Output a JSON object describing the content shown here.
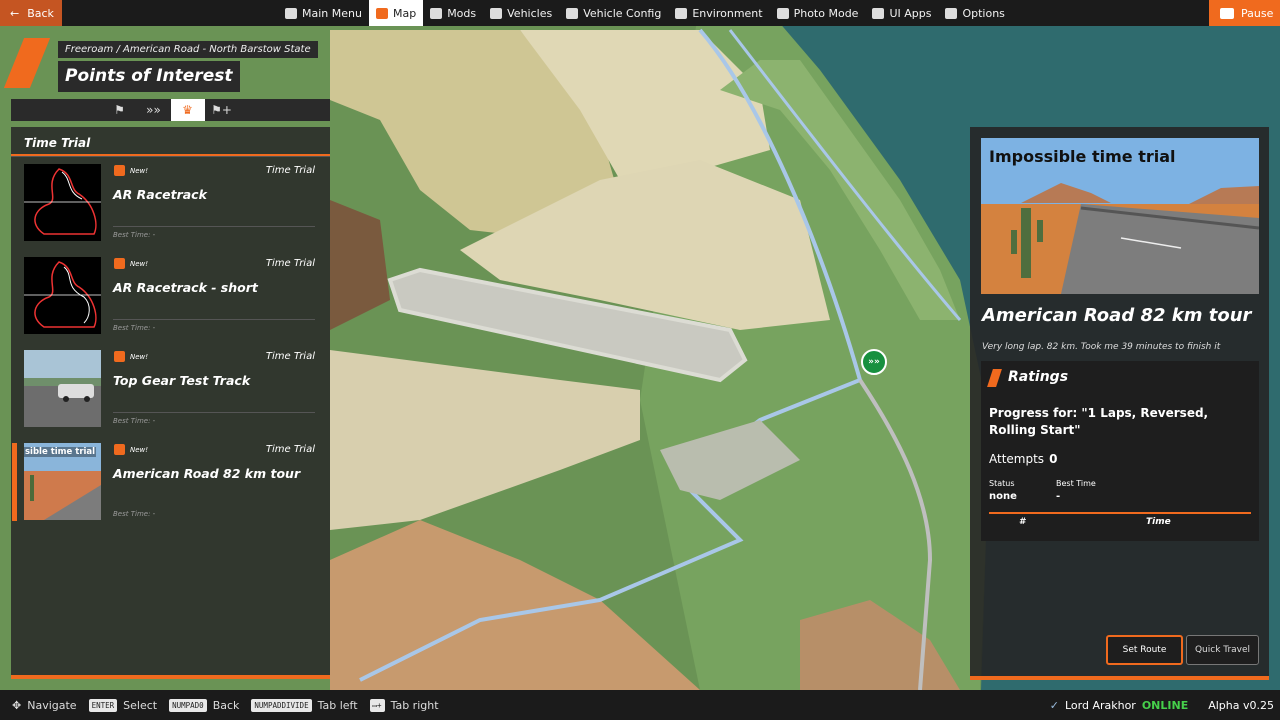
{
  "topbar": {
    "back_label": "Back",
    "pause_label": "Pause",
    "menu": [
      {
        "label": "Main Menu",
        "icon": "grid-icon"
      },
      {
        "label": "Map",
        "icon": "map-icon",
        "active": true
      },
      {
        "label": "Mods",
        "icon": "puzzle-icon"
      },
      {
        "label": "Vehicles",
        "icon": "car-icon"
      },
      {
        "label": "Vehicle Config",
        "icon": "car-config-icon"
      },
      {
        "label": "Environment",
        "icon": "weather-icon"
      },
      {
        "label": "Photo Mode",
        "icon": "camera-icon"
      },
      {
        "label": "UI Apps",
        "icon": "apps-icon"
      },
      {
        "label": "Options",
        "icon": "sliders-icon"
      }
    ]
  },
  "breadcrumb": "Freeroam / American Road - North Barstow State",
  "page_title": "Points of Interest",
  "filter_tabs": [
    {
      "icon": "flag-icon",
      "active": false
    },
    {
      "icon": "chevrons-icon",
      "active": false
    },
    {
      "icon": "trophy-icon",
      "active": true
    },
    {
      "icon": "flag-plus-icon",
      "active": false
    }
  ],
  "list": {
    "section_title": "Time Trial",
    "items": [
      {
        "badge": "New!",
        "type": "Time Trial",
        "name": "AR Racetrack",
        "best": "Best Time: -",
        "thumb": "track-map",
        "selected": false
      },
      {
        "badge": "New!",
        "type": "Time Trial",
        "name": "AR Racetrack - short",
        "best": "Best Time: -",
        "thumb": "track-map",
        "selected": false
      },
      {
        "badge": "New!",
        "type": "Time Trial",
        "name": "Top Gear Test Track",
        "best": "Best Time: -",
        "thumb": "car-photo",
        "selected": false
      },
      {
        "badge": "New!",
        "type": "Time Trial",
        "name": "American Road 82 km tour",
        "best": "Best Time: -",
        "thumb": "desert-photo",
        "thumb_text": "sible time trial",
        "selected": true
      }
    ]
  },
  "detail": {
    "image_title": "Impossible time trial",
    "title": "American Road 82 km tour",
    "description": "Very long lap. 82 km. Took me 39 minutes to finish it",
    "ratings": {
      "heading": "Ratings",
      "progress": "Progress for: \"1 Laps, Reversed, Rolling Start\"",
      "attempts_label": "Attempts",
      "attempts_value": "0",
      "status_label": "Status",
      "status_value": "none",
      "best_label": "Best Time",
      "best_value": "-",
      "col_num": "#",
      "col_time": "Time"
    },
    "set_route": "Set Route",
    "quick_travel": "Quick Travel"
  },
  "bottombar": {
    "hints": [
      {
        "key": "",
        "icon": "dpad-icon",
        "label": "Navigate"
      },
      {
        "key": "ENTER",
        "label": "Select"
      },
      {
        "key": "NUMPAD0",
        "label": "Back"
      },
      {
        "key": "NUMPADDIVIDE",
        "label": "Tab left"
      },
      {
        "key": "",
        "icon": "key-icon",
        "label": "Tab right"
      }
    ],
    "user": "Lord Arakhor",
    "status": "ONLINE",
    "version": "Alpha v0.25"
  },
  "map_marker_symbol": "»»"
}
